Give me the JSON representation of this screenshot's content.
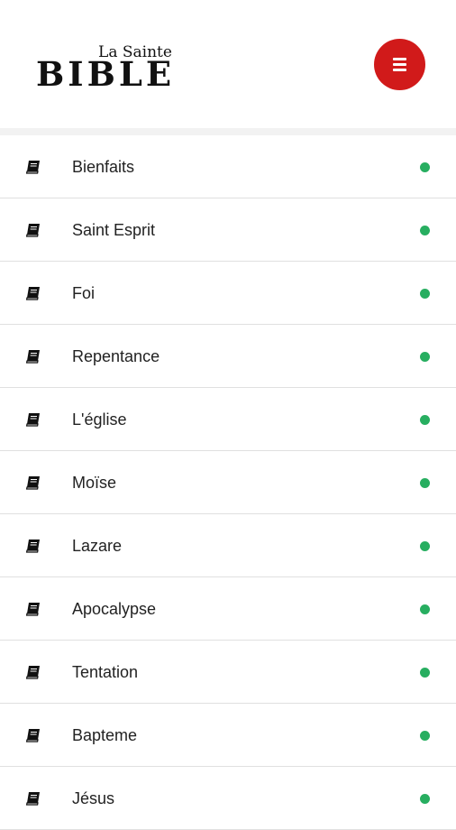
{
  "header": {
    "logo_small": "La Sainte",
    "logo_big": "BIBLE",
    "menu_icon": "hamburger-icon"
  },
  "colors": {
    "accent": "#d11a1a",
    "status": "#27ae60"
  },
  "list": {
    "icon": "book-icon",
    "status_indicator": "green-dot",
    "items": [
      {
        "label": "Bienfaits"
      },
      {
        "label": "Saint Esprit"
      },
      {
        "label": "Foi"
      },
      {
        "label": "Repentance"
      },
      {
        "label": "L'église"
      },
      {
        "label": "Moïse"
      },
      {
        "label": "Lazare"
      },
      {
        "label": "Apocalypse"
      },
      {
        "label": "Tentation"
      },
      {
        "label": "Bapteme"
      },
      {
        "label": "Jésus"
      }
    ]
  }
}
